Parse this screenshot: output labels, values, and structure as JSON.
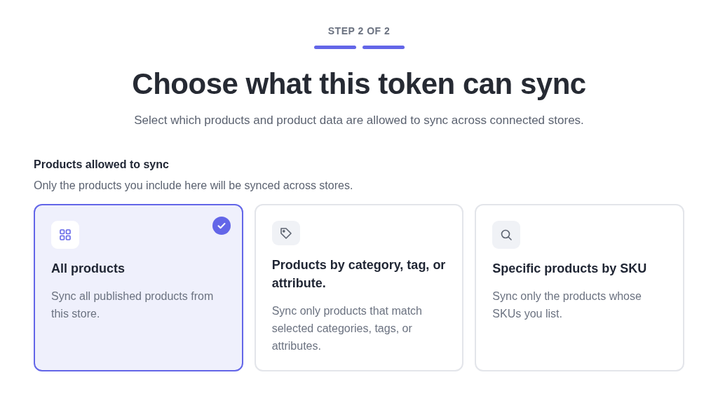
{
  "step_label": "STEP 2 OF 2",
  "steps": [
    {
      "done": true
    },
    {
      "done": true
    }
  ],
  "title": "Choose what this token can sync",
  "subtitle": "Select which products and product data are allowed to sync across connected stores.",
  "section": {
    "heading": "Products allowed to sync",
    "description": "Only the products you include here will be synced across stores.",
    "options": [
      {
        "kind": "grid",
        "title": "All products",
        "description": "Sync all published products from this store.",
        "selected": true
      },
      {
        "kind": "tag",
        "title": "Products by category, tag, or attribute.",
        "description": "Sync only products that match selected categories, tags, or attributes.",
        "selected": false
      },
      {
        "kind": "search",
        "title": "Specific products by SKU",
        "description": "Sync only the products whose SKUs you list.",
        "selected": false
      }
    ]
  }
}
